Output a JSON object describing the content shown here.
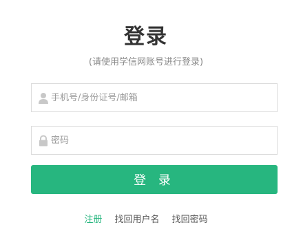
{
  "header": {
    "title": "登录",
    "subtitle": "(请使用学信网账号进行登录)"
  },
  "form": {
    "username": {
      "placeholder": "手机号/身份证号/邮箱",
      "value": "",
      "icon": "user-icon"
    },
    "password": {
      "placeholder": "密码",
      "value": "",
      "icon": "lock-icon"
    },
    "submit_label": "登 录"
  },
  "links": {
    "register": "注册",
    "find_username": "找回用户名",
    "find_password": "找回密码"
  },
  "colors": {
    "accent": "#27b67f",
    "border": "#dcdcdc",
    "muted_text": "#888888"
  }
}
